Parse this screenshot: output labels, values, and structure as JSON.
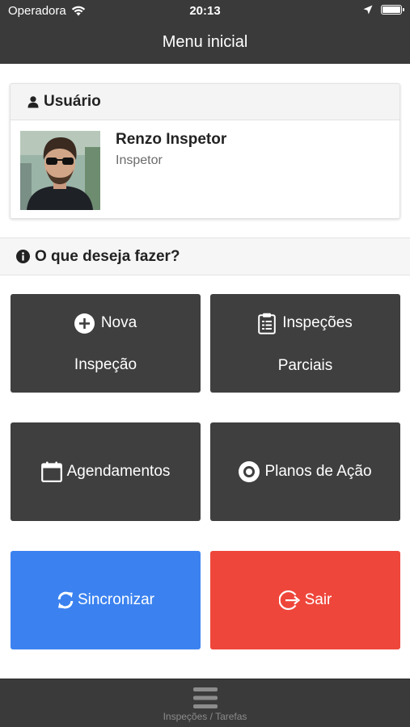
{
  "status_bar": {
    "carrier": "Operadora",
    "time": "20:13"
  },
  "header": {
    "title": "Menu inicial"
  },
  "user_card": {
    "header_label": "Usuário",
    "name": "Renzo Inspetor",
    "role": "Inspetor"
  },
  "section": {
    "label": "O que deseja fazer?"
  },
  "actions": {
    "nova_inspecao": {
      "line1": "Nova",
      "line2": "Inspeção"
    },
    "inspecoes_parciais": {
      "line1": "Inspeções",
      "line2": "Parciais"
    },
    "agendamentos": {
      "label": "Agendamentos"
    },
    "planos_acao": {
      "label": "Planos de Ação"
    },
    "sincronizar": {
      "label": "Sincronizar"
    },
    "sair": {
      "label": "Sair"
    }
  },
  "tab_bar": {
    "items": [
      {
        "label": "Inspeções / Tarefas",
        "icon": "menu-icon"
      }
    ]
  },
  "colors": {
    "bar": "#3a3a3a",
    "tile_dark": "#3f3f3f",
    "sync_blue": "#3b82f0",
    "exit_red": "#ef463b"
  }
}
